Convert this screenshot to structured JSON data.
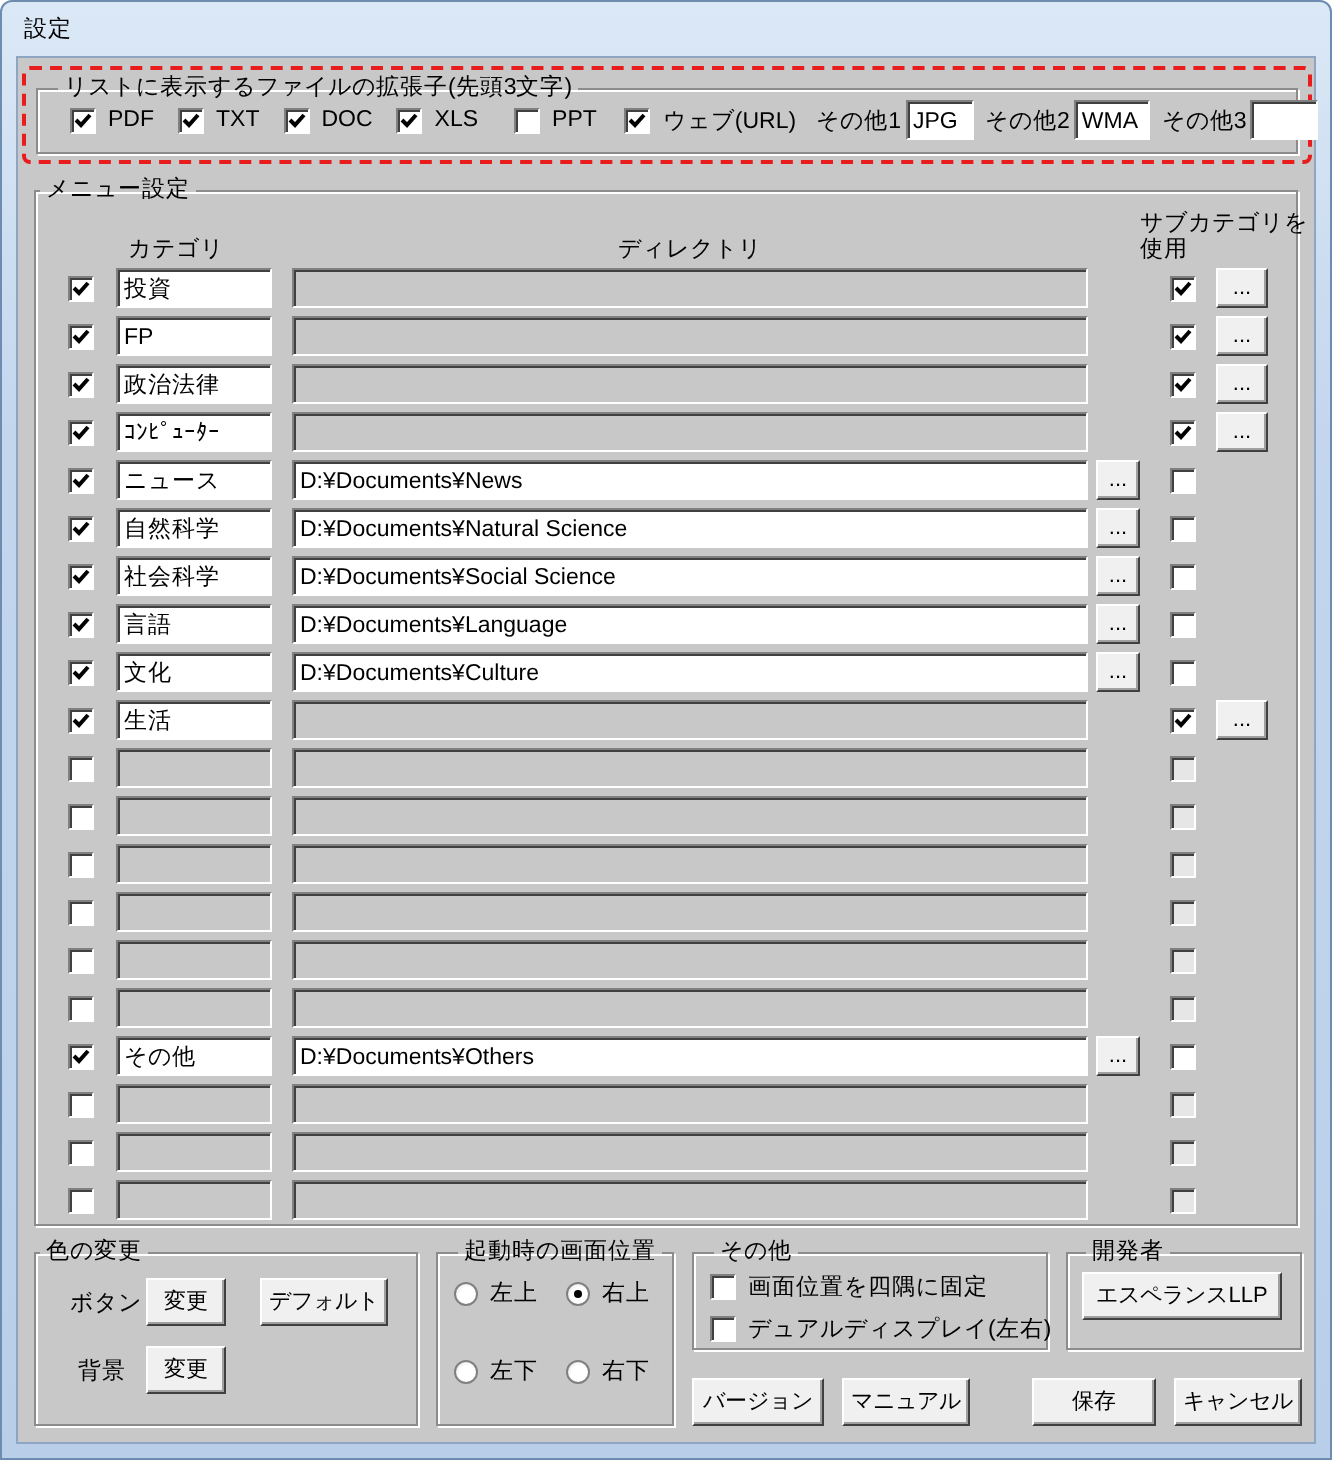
{
  "window": {
    "title": "設定"
  },
  "extensions": {
    "title": "リストに表示するファイルの拡張子(先頭3文字)",
    "items": [
      {
        "label": "PDF",
        "checked": true
      },
      {
        "label": "TXT",
        "checked": true
      },
      {
        "label": "DOC",
        "checked": true
      },
      {
        "label": "XLS",
        "checked": true
      },
      {
        "label": "PPT",
        "checked": false
      },
      {
        "label": "ウェブ(URL)",
        "checked": true
      }
    ],
    "others": [
      {
        "label": "その他1",
        "value": "JPG"
      },
      {
        "label": "その他2",
        "value": "WMA"
      },
      {
        "label": "その他3"
      }
    ]
  },
  "menu": {
    "title": "メニュー設定",
    "columns": [
      "カテゴリ",
      "ディレクトリ",
      "サブカテゴリを使用"
    ],
    "rows": [
      {
        "enabled": true,
        "category": "投資",
        "use_subcategory": true,
        "subcategory_button": "..."
      },
      {
        "enabled": true,
        "category": "FP",
        "use_subcategory": true,
        "subcategory_button": "..."
      },
      {
        "enabled": true,
        "category": "政治法律",
        "use_subcategory": true,
        "subcategory_button": "..."
      },
      {
        "enabled": true,
        "category": "ｺﾝﾋﾟｭｰﾀｰ",
        "use_subcategory": true,
        "subcategory_button": "..."
      },
      {
        "enabled": true,
        "category": "ニュース",
        "directory": "D:¥Documents¥News",
        "directory_button": "...",
        "use_subcategory": false
      },
      {
        "enabled": true,
        "category": "自然科学",
        "directory": "D:¥Documents¥Natural Science",
        "directory_button": "...",
        "use_subcategory": false
      },
      {
        "enabled": true,
        "category": "社会科学",
        "directory": "D:¥Documents¥Social Science",
        "directory_button": "...",
        "use_subcategory": false
      },
      {
        "enabled": true,
        "category": "言語",
        "directory": "D:¥Documents¥Language",
        "directory_button": "...",
        "use_subcategory": false
      },
      {
        "enabled": true,
        "category": "文化",
        "directory": "D:¥Documents¥Culture",
        "directory_button": "...",
        "use_subcategory": false
      },
      {
        "enabled": true,
        "category": "生活",
        "use_subcategory": true,
        "subcategory_button": "..."
      },
      {
        "enabled": false,
        "use_subcategory": false
      },
      {
        "enabled": false,
        "use_subcategory": false
      },
      {
        "enabled": false,
        "use_subcategory": false
      },
      {
        "enabled": false,
        "use_subcategory": false
      },
      {
        "enabled": false,
        "use_subcategory": false
      },
      {
        "enabled": false,
        "use_subcategory": false
      },
      {
        "enabled": true,
        "category": "その他",
        "directory": "D:¥Documents¥Others",
        "directory_button": "...",
        "use_subcategory": false
      },
      {
        "enabled": false,
        "use_subcategory": false
      },
      {
        "enabled": false,
        "use_subcategory": false
      },
      {
        "enabled": false,
        "use_subcategory": false
      }
    ]
  },
  "color": {
    "title": "色の変更",
    "rows": [
      {
        "label": "ボタン",
        "buttons": [
          "変更",
          "デフォルト"
        ]
      },
      {
        "label": "背景",
        "buttons": [
          "変更"
        ]
      }
    ]
  },
  "startup_position": {
    "title": "起動時の画面位置",
    "options": [
      {
        "label": "左上",
        "selected": false
      },
      {
        "label": "右上",
        "selected": true
      },
      {
        "label": "左下",
        "selected": false
      },
      {
        "label": "右下",
        "selected": false
      }
    ]
  },
  "other": {
    "title": "その他",
    "options": [
      {
        "label": "画面位置を四隅に固定",
        "checked": false
      },
      {
        "label": "デュアルディスプレイ(左右)",
        "checked": false
      }
    ]
  },
  "developer": {
    "title": "開発者",
    "button": "エスペランスLLP"
  },
  "buttons": [
    "バージョン",
    "マニュアル",
    "保存",
    "キャンセル"
  ]
}
